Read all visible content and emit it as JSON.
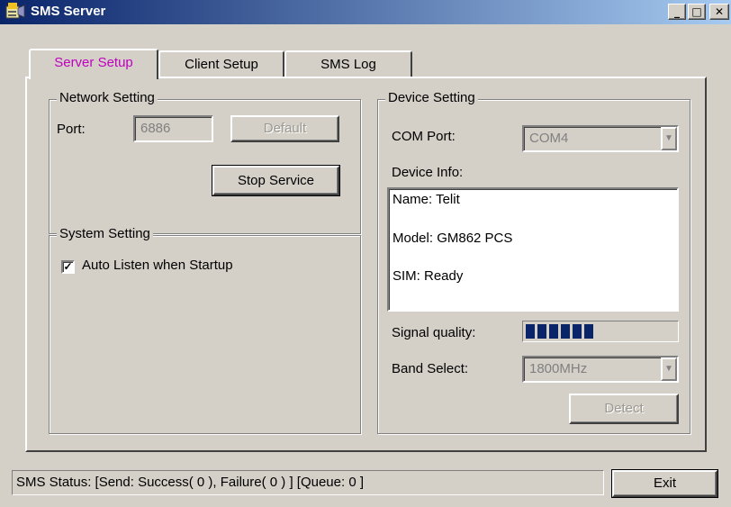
{
  "window": {
    "title": "SMS Server",
    "icon": "sms-app-icon"
  },
  "caption_buttons": [
    "minimize",
    "maximize",
    "close"
  ],
  "tabs": [
    {
      "label": "Server Setup",
      "active": true
    },
    {
      "label": "Client Setup",
      "active": false
    },
    {
      "label": "SMS Log",
      "active": false
    }
  ],
  "network": {
    "legend": "Network Setting",
    "port_label": "Port:",
    "port_value": "6886",
    "default_label": "Default",
    "stop_label": "Stop Service"
  },
  "system": {
    "legend": "System Setting",
    "auto_listen_label": "Auto Listen when Startup",
    "auto_listen_checked": true
  },
  "device": {
    "legend": "Device Setting",
    "com_label": "COM Port:",
    "com_value": "COM4",
    "info_label": "Device Info:",
    "info_lines": [
      "Name: Telit",
      "Model: GM862 PCS",
      "SIM: Ready"
    ],
    "signal_label": "Signal quality:",
    "signal_bars": 6,
    "band_label": "Band Select:",
    "band_value": "1800MHz",
    "detect_label": "Detect"
  },
  "status": {
    "text": "SMS Status: [Send: Success( 0 ), Failure( 0 ) ] [Queue: 0 ]"
  },
  "exit_label": "Exit",
  "colors": {
    "title_start": "#0a246a",
    "title_end": "#a6caf0",
    "active_tab": "#c000c0",
    "signal": "#0a246a",
    "face": "#d4d0c8"
  }
}
